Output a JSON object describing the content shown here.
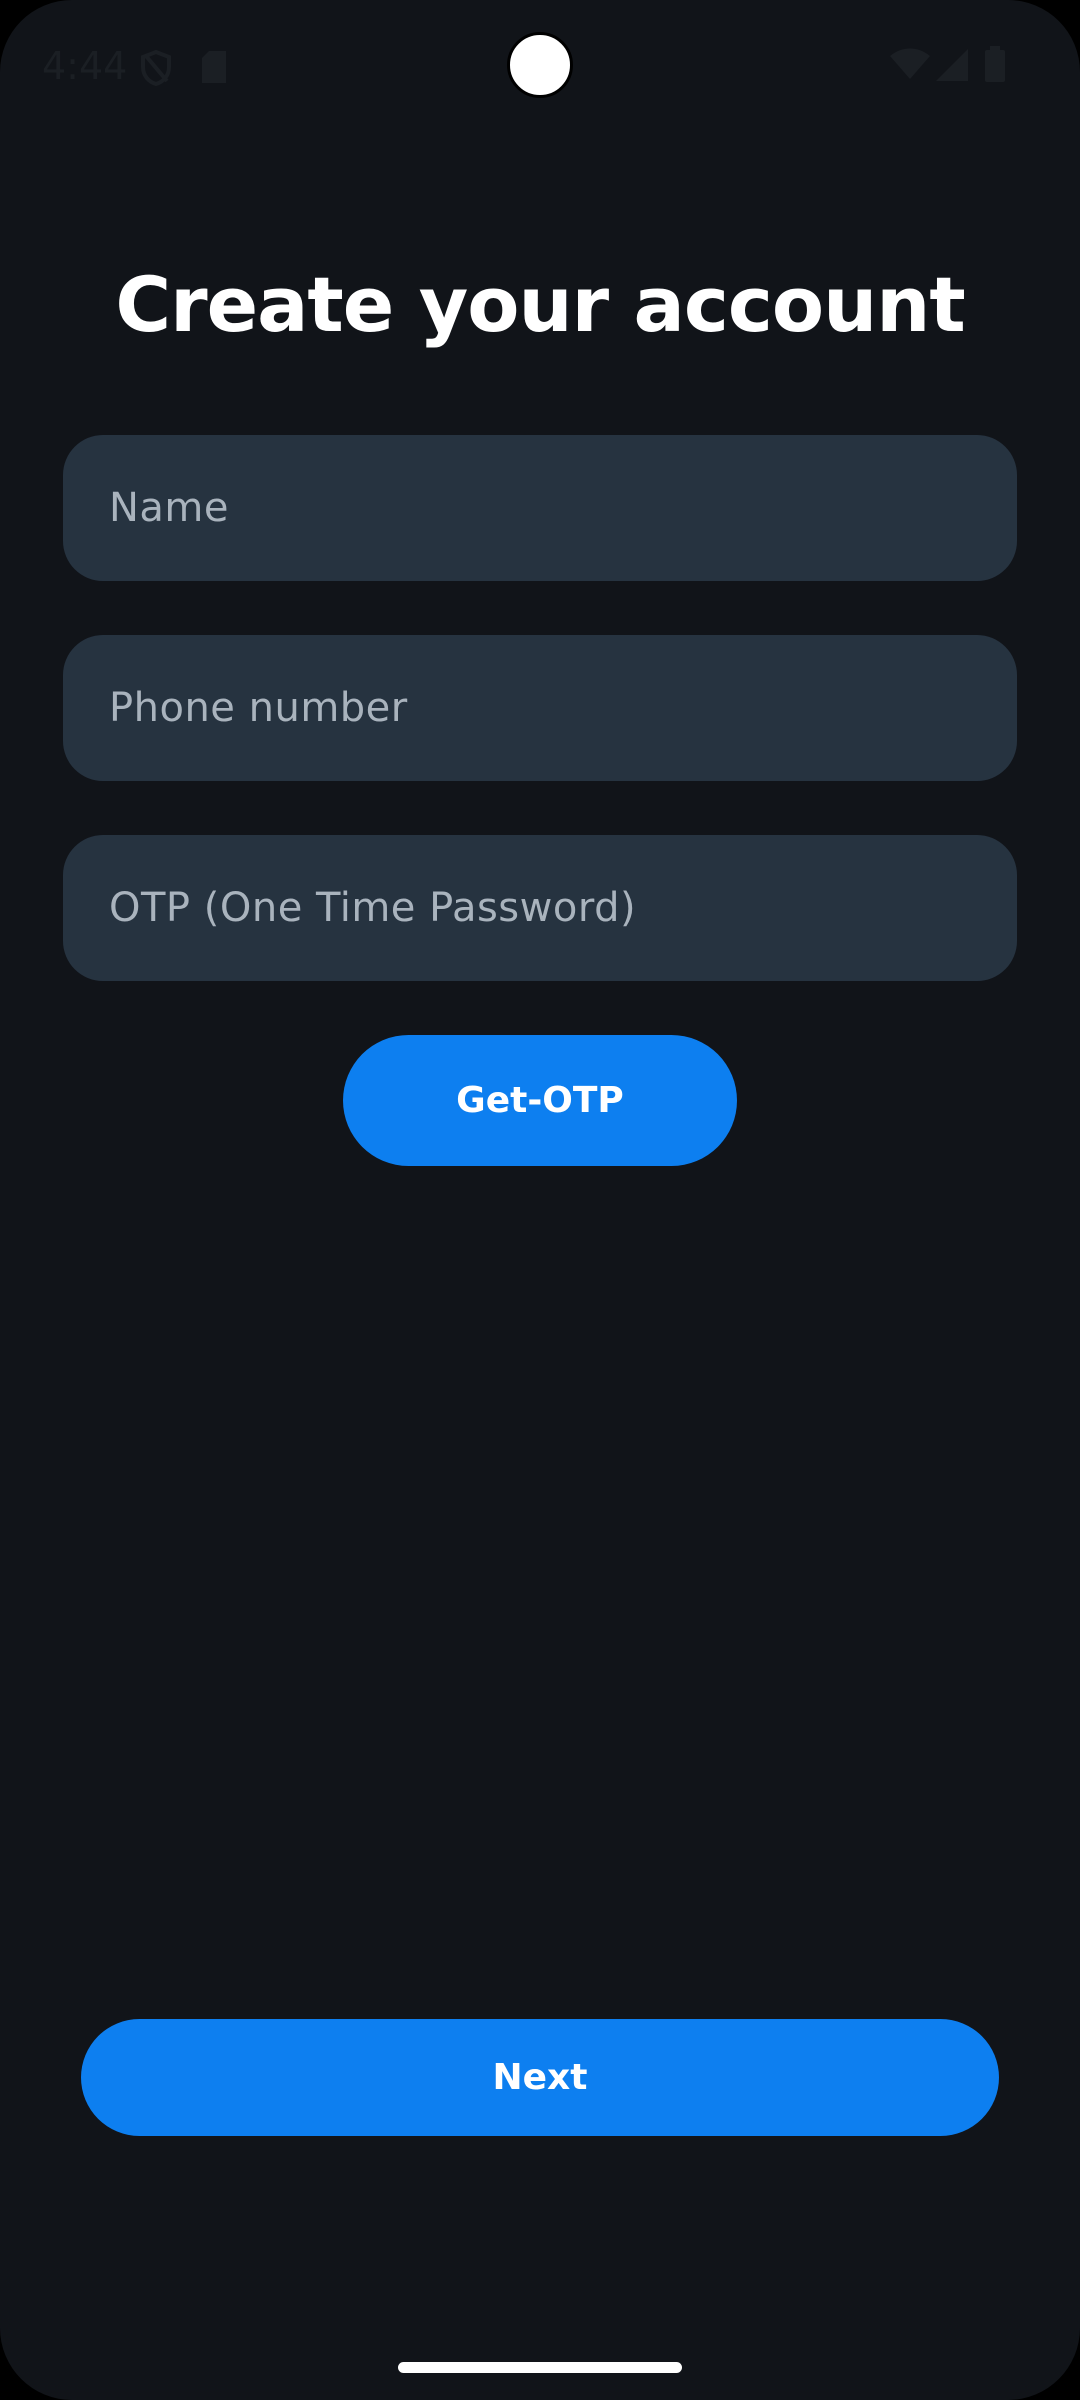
{
  "status_bar": {
    "time": "4:44",
    "icons": [
      "shield-icon",
      "sd-card-icon",
      "wifi-icon",
      "cellular-signal-icon",
      "battery-icon"
    ]
  },
  "form": {
    "title": "Create your account",
    "name_placeholder": "Name",
    "phone_placeholder": "Phone number",
    "otp_placeholder": "OTP (One Time Password)",
    "get_otp_label": "Get-OTP",
    "next_label": "Next"
  },
  "colors": {
    "background": "#111419",
    "field_background": "#263340",
    "accent": "#0d7ff0",
    "placeholder": "#a9b3bd"
  }
}
